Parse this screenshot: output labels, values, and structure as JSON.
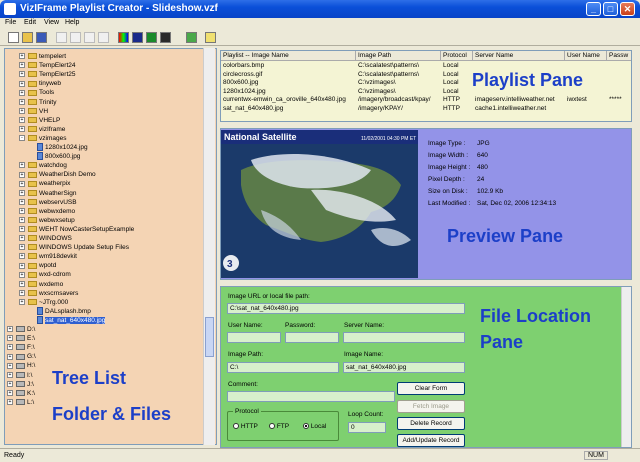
{
  "window": {
    "title": "VizIFrame Playlist Creator - Slideshow.vzf",
    "btn_min": "_",
    "btn_max": "□",
    "btn_close": "✕"
  },
  "menu": [
    "File",
    "Edit",
    "View",
    "Help"
  ],
  "tree": {
    "items": [
      {
        "label": "tempelert",
        "type": "folder",
        "expander": "+"
      },
      {
        "label": "TempElert24",
        "type": "folder",
        "expander": "+"
      },
      {
        "label": "TempElert25",
        "type": "folder",
        "expander": "+"
      },
      {
        "label": "tinyweb",
        "type": "folder",
        "expander": "+"
      },
      {
        "label": "Tools",
        "type": "folder",
        "expander": "+"
      },
      {
        "label": "Trinity",
        "type": "folder",
        "expander": "+"
      },
      {
        "label": "VH",
        "type": "folder",
        "expander": "+"
      },
      {
        "label": "VHELP",
        "type": "folder",
        "expander": "+"
      },
      {
        "label": "vizIframe",
        "type": "folder",
        "expander": "+"
      },
      {
        "label": "vzimages",
        "type": "folder",
        "expander": "-"
      },
      {
        "label": "1280x1024.jpg",
        "type": "file",
        "expander": ""
      },
      {
        "label": "800x600.jpg",
        "type": "file",
        "expander": ""
      },
      {
        "label": "watchdog",
        "type": "folder",
        "expander": "+"
      },
      {
        "label": "WeatherDish Demo",
        "type": "folder",
        "expander": "+"
      },
      {
        "label": "weatherpix",
        "type": "folder",
        "expander": "+"
      },
      {
        "label": "WeatherSign",
        "type": "folder",
        "expander": "+"
      },
      {
        "label": "webservUSB",
        "type": "folder",
        "expander": "+"
      },
      {
        "label": "webwxdemo",
        "type": "folder",
        "expander": "+"
      },
      {
        "label": "webwxsetup",
        "type": "folder",
        "expander": "+"
      },
      {
        "label": "WEHT NowCasterSetupExample",
        "type": "folder",
        "expander": "+"
      },
      {
        "label": "WINDOWS",
        "type": "folder",
        "expander": "+"
      },
      {
        "label": "WINDOWS Update Setup Files",
        "type": "folder",
        "expander": "+"
      },
      {
        "label": "wm918devkit",
        "type": "folder",
        "expander": "+"
      },
      {
        "label": "wpotd",
        "type": "folder",
        "expander": "+"
      },
      {
        "label": "wxd-cdrom",
        "type": "folder",
        "expander": "+"
      },
      {
        "label": "wxdemo",
        "type": "folder",
        "expander": "+"
      },
      {
        "label": "wxscrnsavers",
        "type": "folder",
        "expander": "+"
      },
      {
        "label": "~JTrg.000",
        "type": "folder",
        "expander": "+"
      },
      {
        "label": "DALsplash.bmp",
        "type": "file",
        "expander": ""
      },
      {
        "label": "sat_nat_640x480.jpg",
        "type": "file",
        "expander": "",
        "selected": true
      }
    ],
    "drives": [
      "D:\\",
      "E:\\",
      "F:\\",
      "G:\\",
      "H:\\",
      "I:\\",
      "J:\\",
      "K:\\",
      "L:\\"
    ],
    "overlay_line1": "Tree List",
    "overlay_line2": "Folder & Files"
  },
  "playlist": {
    "overlay": "Playlist Pane",
    "columns": [
      "Playlist -- Image Name",
      "Image Path",
      "Protocol",
      "Server Name",
      "User Name",
      "Passw"
    ],
    "rows": [
      [
        "colorbars.bmp",
        "C:\\scalatest\\patterns\\",
        "Local",
        "",
        "",
        ""
      ],
      [
        "circlecross.gif",
        "C:\\scalatest\\patterns\\",
        "Local",
        "",
        "",
        ""
      ],
      [
        "800x600.jpg",
        "C:\\vzimages\\",
        "Local",
        "",
        "",
        ""
      ],
      [
        "1280x1024.jpg",
        "C:\\vzimages\\",
        "Local",
        "",
        "",
        ""
      ],
      [
        "currentwx-emwin_ca_oroville_640x480.jpg",
        "/imagery/broadcast/kpay/",
        "HTTP",
        "imageserv.intelliweather.net",
        "iwxtest",
        "*****"
      ],
      [
        "sat_nat_640x480.jpg",
        "/imagery/KPAY/",
        "HTTP",
        "cache1.intelliweather.net",
        "",
        ""
      ]
    ]
  },
  "preview": {
    "overlay": "Preview Pane",
    "image_title": "National Satellite",
    "image_timestamp": "11/02/2001  04:30 PM ET",
    "logo_text": "3",
    "labels": [
      "Image Type :",
      "Image Width :",
      "Image Height :",
      "Pixel Depth :",
      "Size on Disk :",
      "Last Modified :"
    ],
    "values": [
      "JPG",
      "640",
      "480",
      "24",
      "102.9 Kb",
      "Sat, Dec 02, 2006  12:34:13"
    ]
  },
  "fileloc": {
    "overlay_line1": "File Location",
    "overlay_line2": "Pane",
    "url_label": "Image URL or local file path:",
    "url_value": "C:\\sat_nat_640x480.jpg",
    "user_label": "User Name:",
    "pass_label": "Password:",
    "server_label": "Server Name:",
    "path_label": "Image Path:",
    "path_value": "C:\\",
    "name_label": "Image Name:",
    "name_value": "sat_nat_640x480.jpg",
    "comment_label": "Comment:",
    "protocol_label": "Protocol",
    "protocols": [
      "HTTP",
      "FTP",
      "Local"
    ],
    "protocol_selected": "Local",
    "loop_label": "Loop Count:",
    "loop_value": "0",
    "btn_clear": "Clear Form",
    "btn_fetch": "Fetch Image",
    "btn_delete": "Delete Record",
    "btn_add": "Add/Update Record"
  },
  "status": {
    "text": "Ready",
    "num": "NUM"
  },
  "colors": {
    "title_blue": "#0a4fd8",
    "tree_bg": "#f4d4b4",
    "playlist_bg": "#f4f4d4",
    "preview_bg": "#9393e8",
    "fileloc_bg": "#7ed070",
    "overlay_text": "#1c3fc8"
  }
}
